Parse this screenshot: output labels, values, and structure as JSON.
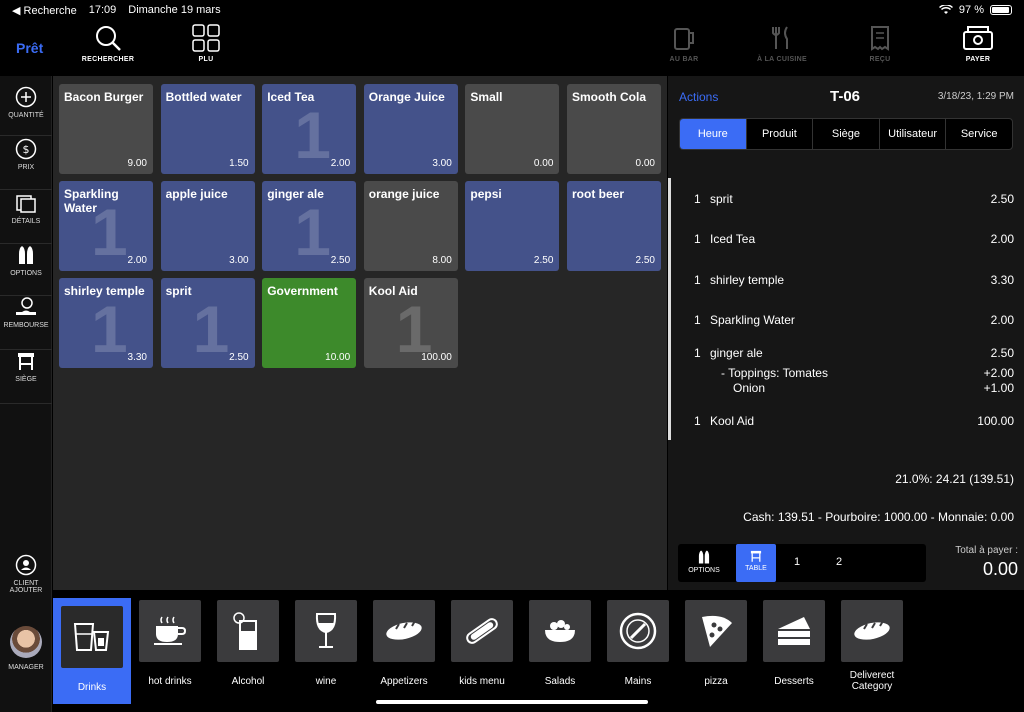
{
  "status": {
    "back": "◀ Recherche",
    "time": "17:09",
    "date": "Dimanche 19 mars",
    "battery": "97 %"
  },
  "top": {
    "ready": "Prêt",
    "search": "RECHERCHER",
    "plu": "PLU",
    "bar": "AU BAR",
    "kitchen": "À LA CUISINE",
    "receipt": "REÇU",
    "pay": "PAYER"
  },
  "sidebar": {
    "quantity": "QUANTITÉ",
    "price": "PRIX",
    "details": "DÉTAILS",
    "options": "OPTIONS",
    "refund": "REMBOURSE",
    "seat": "SIÈGE",
    "client_line1": "CLIENT",
    "client_line2": "AJOUTER",
    "manager": "MANAGER"
  },
  "products": [
    {
      "name": "Bacon Burger",
      "price": "9.00"
    },
    {
      "name": "Bottled water",
      "price": "1.50"
    },
    {
      "name": "Iced Tea",
      "price": "2.00",
      "badge": "1"
    },
    {
      "name": "Orange Juice",
      "price": "3.00"
    },
    {
      "name": "Small",
      "price": "0.00"
    },
    {
      "name": "Smooth Cola",
      "price": "0.00"
    },
    {
      "name": "Sparkling Water",
      "price": "2.00",
      "badge": "1"
    },
    {
      "name": "apple juice",
      "price": "3.00"
    },
    {
      "name": "ginger ale",
      "price": "2.50",
      "badge": "1"
    },
    {
      "name": "orange juice",
      "price": "8.00"
    },
    {
      "name": "pepsi",
      "price": "2.50"
    },
    {
      "name": "root beer",
      "price": "2.50"
    },
    {
      "name": "shirley temple",
      "price": "3.30",
      "badge": "1"
    },
    {
      "name": "sprit",
      "price": "2.50",
      "badge": "1"
    },
    {
      "name": "Government",
      "price": "10.00"
    },
    {
      "name": "Kool Aid",
      "price": "100.00",
      "badge": "1"
    }
  ],
  "order": {
    "actions": "Actions",
    "table": "T-06",
    "datetime": "3/18/23, 1:29 PM",
    "tabs": [
      "Heure",
      "Produit",
      "Siège",
      "Utilisateur",
      "Service"
    ],
    "lines": [
      {
        "qty": "1",
        "name": "sprit",
        "price": "2.50"
      },
      {
        "qty": "1",
        "name": "Iced Tea",
        "price": "2.00"
      },
      {
        "qty": "1",
        "name": "shirley temple",
        "price": "3.30"
      },
      {
        "qty": "1",
        "name": "Sparkling Water",
        "price": "2.00"
      },
      {
        "qty": "1",
        "name": "ginger ale",
        "price": "2.50"
      },
      {
        "qty": "1",
        "name": "Kool Aid",
        "price": "100.00"
      }
    ],
    "modifiers": [
      {
        "text": "- Toppings:  Tomates",
        "price": "+2.00"
      },
      {
        "text": "Onion",
        "price": "+1.00"
      }
    ],
    "tax": "21.0%: 24.21 (139.51)",
    "payment": "Cash: 139.51  - Pourboire: 1000.00 - Monnaie: 0.00"
  },
  "footer": {
    "options": "OPTIONS",
    "table": "TABLE",
    "seat1": "1",
    "seat2": "2",
    "total_label": "Total à payer :",
    "total_value": "0.00"
  },
  "categories": [
    {
      "label": "Drinks",
      "icon": "drinks-icon"
    },
    {
      "label": "hot drinks",
      "icon": "coffee-cup-icon"
    },
    {
      "label": "Alcohol",
      "icon": "cocktail-icon"
    },
    {
      "label": "wine",
      "icon": "wine-glass-icon"
    },
    {
      "label": "Appetizers",
      "icon": "bread-icon"
    },
    {
      "label": "kids menu",
      "icon": "hotdog-icon"
    },
    {
      "label": "Salads",
      "icon": "salad-bowl-icon"
    },
    {
      "label": "Mains",
      "icon": "plate-icon"
    },
    {
      "label": "pizza",
      "icon": "pizza-icon"
    },
    {
      "label": "Desserts",
      "icon": "cake-icon"
    },
    {
      "label_line1": "Deliverect",
      "label_line2": "Category",
      "icon": "bread-icon"
    }
  ],
  "colors": {
    "accent": "#3b6cf5",
    "tile_blue": "#44528a",
    "tile_gray": "#4a4a4a",
    "tile_green": "#3d8a2b"
  }
}
